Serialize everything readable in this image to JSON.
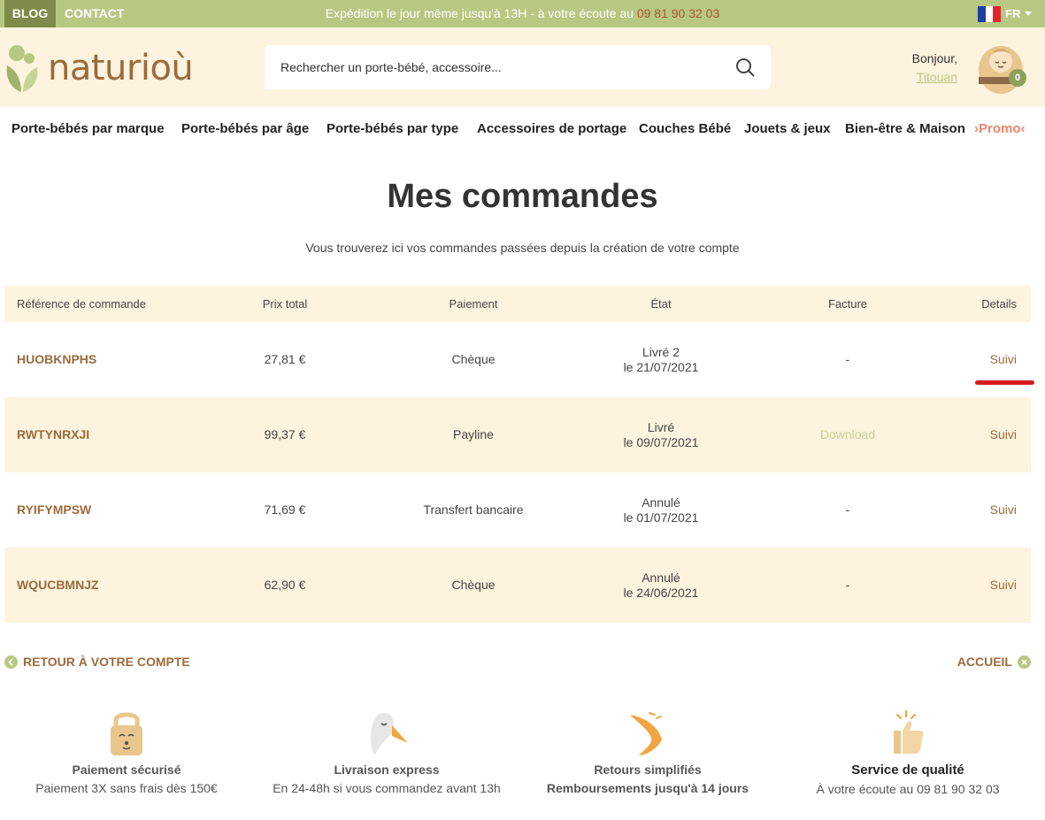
{
  "topbar": {
    "blog": "BLOG",
    "contact": "CONTACT",
    "shipping_text": "Expédition le jour même jusqu'à 13H - à votre écoute au ",
    "phone": "09 81 90 32 03",
    "lang": "FR"
  },
  "header": {
    "logo_text": "naturioù",
    "search_placeholder": "Rechercher un porte-bébé, accessoire...",
    "greeting": "Bonjour,",
    "user_name": "Titouan",
    "cart_count": "0"
  },
  "nav": {
    "items": [
      "Porte-bébés par marque",
      "Porte-bébés par âge",
      "Porte-bébés par type",
      "Accessoires de portage",
      "Couches Bébé",
      "Jouets & jeux",
      "Bien-être & Maison"
    ],
    "promo": "Promo"
  },
  "page": {
    "title": "Mes commandes",
    "subtitle": "Vous trouverez ici vos commandes passées depuis la création de votre compte"
  },
  "table": {
    "headers": {
      "ref": "Référence de commande",
      "price": "Prix total",
      "payment": "Paiement",
      "state": "État",
      "invoice": "Facture",
      "details": "Details"
    },
    "rows": [
      {
        "ref": "HUOBKNPHS",
        "price": "27,81 €",
        "payment": "Chèque",
        "state": "Livré 2",
        "date": "le 21/07/2021",
        "invoice": "-",
        "details": "Suivi"
      },
      {
        "ref": "RWTYNRXJI",
        "price": "99,37 €",
        "payment": "Payline",
        "state": "Livré",
        "date": "le 09/07/2021",
        "invoice": "Download",
        "details": "Suivi"
      },
      {
        "ref": "RYIFYMPSW",
        "price": "71,69 €",
        "payment": "Transfert bancaire",
        "state": "Annulé",
        "date": "le 01/07/2021",
        "invoice": "-",
        "details": "Suivi"
      },
      {
        "ref": "WQUCBMNJZ",
        "price": "62,90 €",
        "payment": "Chèque",
        "state": "Annulé",
        "date": "le 24/06/2021",
        "invoice": "-",
        "details": "Suivi"
      }
    ]
  },
  "links": {
    "back": "RETOUR À VOTRE COMPTE",
    "home": "ACCUEIL"
  },
  "features": [
    {
      "icon": "padlock-icon",
      "title": "Paiement sécurisé",
      "desc": "Paiement 3X sans frais dès 150€"
    },
    {
      "icon": "stork-icon",
      "title": "Livraison express",
      "desc": "En 24-48h si vous commandez avant 13h"
    },
    {
      "icon": "boomerang-icon",
      "title": "Retours simplifiés",
      "desc": "Remboursements jusqu'à 14 jours"
    },
    {
      "icon": "thumbs-up-icon",
      "title": "Service de qualité",
      "desc": "À votre écoute au 09 81 90 32 03"
    }
  ],
  "colors": {
    "topbar": "#b7c883",
    "accent_brown": "#9a6b3c",
    "cream": "#fdf3de",
    "promo": "#e9866c",
    "highlight": "#d41c1c"
  }
}
